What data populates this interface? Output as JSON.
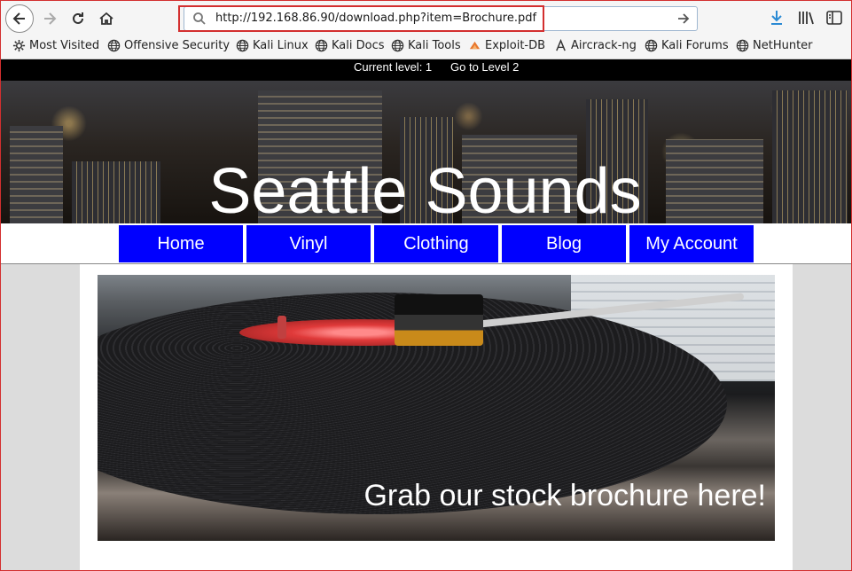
{
  "browser": {
    "url": "http://192.168.86.90/download.php?item=Brochure.pdf",
    "bookmarks": [
      "Most Visited",
      "Offensive Security",
      "Kali Linux",
      "Kali Docs",
      "Kali Tools",
      "Exploit-DB",
      "Aircrack-ng",
      "Kali Forums",
      "NetHunter"
    ]
  },
  "levelbar": {
    "current": "Current level:  1",
    "goto": "Go to Level 2"
  },
  "site": {
    "title": "Seattle Sounds"
  },
  "nav": [
    "Home",
    "Vinyl",
    "Clothing",
    "Blog",
    "My Account"
  ],
  "hero": {
    "caption": "Grab our stock brochure here!"
  },
  "colors": {
    "nav_bg": "#0000ff",
    "highlight": "#d32f2f",
    "level_bar": "#000000"
  }
}
